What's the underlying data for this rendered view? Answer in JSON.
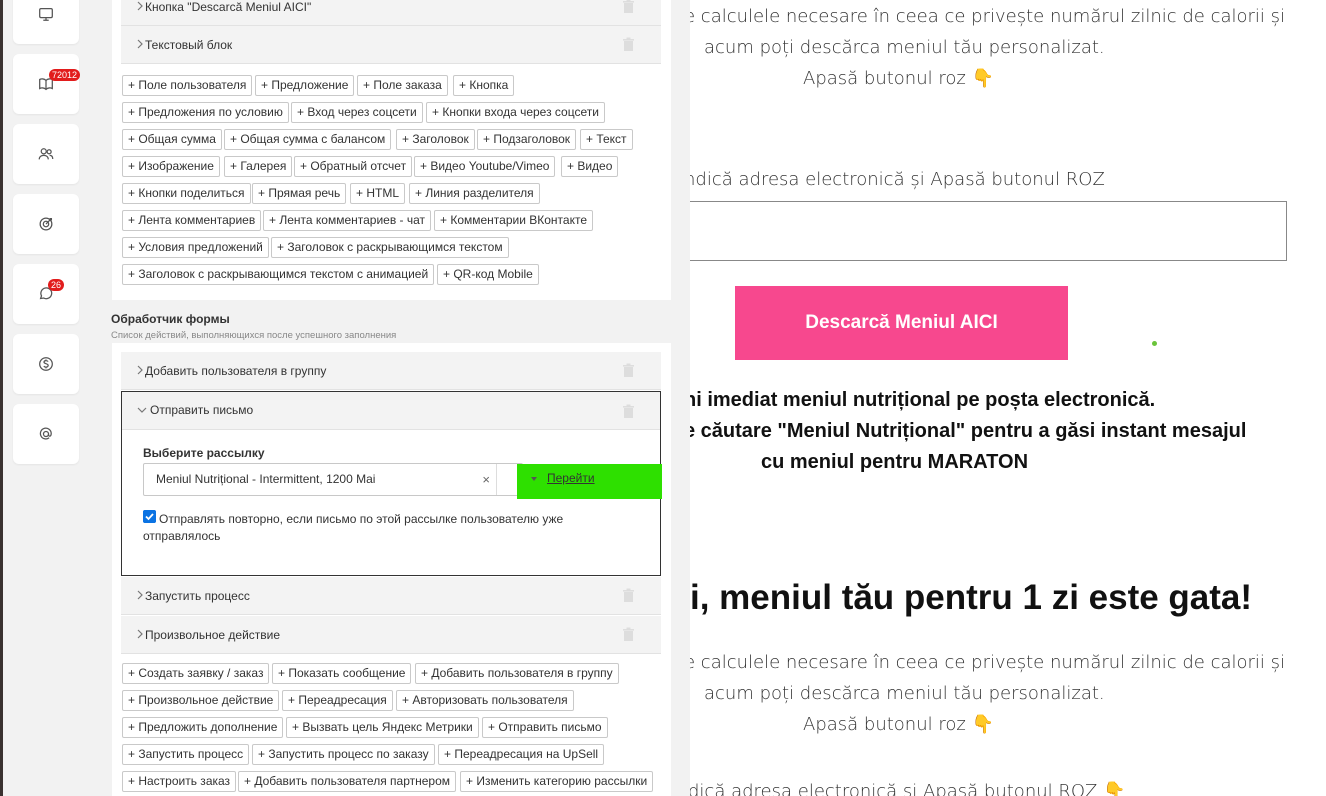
{
  "sidebar": {
    "items": [
      {
        "icon": "monitor-icon"
      },
      {
        "icon": "book-icon",
        "badge": "72012"
      },
      {
        "icon": "users-icon"
      },
      {
        "icon": "target-icon"
      },
      {
        "icon": "chat-icon",
        "badge": "26"
      },
      {
        "icon": "dollar-icon"
      },
      {
        "icon": "at-sign-icon"
      }
    ]
  },
  "editor": {
    "top_rows": [
      "Кнопка \"Descarcă Meniul AICI\"",
      "Текстовый блок"
    ],
    "blocks_chips": [
      "+ Поле пользователя",
      "+ Предложение",
      "+ Поле заказа",
      "+ Кнопка",
      "+ Предложения по условию",
      "+ Вход через соцсети",
      "+ Кнопки входа через соцсети",
      "+ Общая сумма",
      "+ Общая сумма с балансом",
      "+ Заголовок",
      "+ Подзаголовок",
      "+ Текст",
      "+ Изображение",
      "+ Галерея",
      "+ Обратный отсчет",
      "+ Видео Youtube/Vimeo",
      "+ Видео",
      "+ Кнопки поделиться",
      "+ Прямая речь",
      "+ HTML",
      "+ Линия разделителя",
      "+ Лента комментариев",
      "+ Лента комментариев - чат",
      "+ Комментарии ВКонтакте",
      "+ Условия предложений",
      "+ Заголовок с раскрывающимся текстом",
      "+ Заголовок с раскрывающимся текстом с анимацией",
      "+ QR-код Mobile"
    ],
    "form_handler": {
      "title": "Обработчик формы",
      "subtitle": "Список действий, выполняющихся после успешного заполнения",
      "rows": {
        "add_to_group": "Добавить пользователя в группу",
        "send_letter": "Отправить письмо",
        "run_process": "Запустить процесс",
        "custom_action": "Произвольное действие"
      },
      "send_letter": {
        "field_label": "Выберите рассылку",
        "selected": "Meniul Nutrițional - Intermittent, 1200 Mai",
        "clear": "×",
        "goto_link": "Перейти",
        "checkbox_checked": true,
        "checkbox_label": "Отправлять повторно, если письмо по этой рассылке пользователю уже отправлялось"
      },
      "action_chips": [
        "+ Создать заявку / заказ",
        "+ Показать сообщение",
        "+ Добавить пользователя в группу",
        "+ Произвольное действие",
        "+ Переадресация",
        "+ Авторизовать пользователя",
        "+ Предложить дополнение",
        "+ Вызвать цель Яндекс Метрики",
        "+ Отправить письмо",
        "+ Запустить процесс",
        "+ Запустить процесс по заказу",
        "+ Переадресация на UpSell",
        "+ Настроить заказ",
        "+ Добавить пользователя партнером",
        "+ Изменить категорию рассылки"
      ]
    }
  },
  "preview": {
    "line1": "e calculele necesare în ceea ce privește numărul zilnic de calorii și",
    "line2": "acum poți descărca meniul tău personalizat.",
    "line3": "Apasă butonul roz 👇",
    "email_prompt": "ndică adresa electronică și Apasă butonul ROZ",
    "button": "Descarcă Meniul AICI",
    "info1": "ni imediat meniul nutrițional pe poșta electronică.",
    "info2": "e căutare \"Meniul Nutrițional\" pentru a găsi instant mesajul",
    "info3": "cu meniul pentru MARATON",
    "big_title": "i, meniul tău pentru 1 zi este gata!",
    "line4": "e calculele necesare în ceea ce privește numărul zilnic de calorii și",
    "line5": "acum poți descărca meniul tău personalizat.",
    "line6": "Apasă butonul roz 👇",
    "email_prompt2": "dică adresa electronică și Apasă butonul ROZ 👇"
  }
}
